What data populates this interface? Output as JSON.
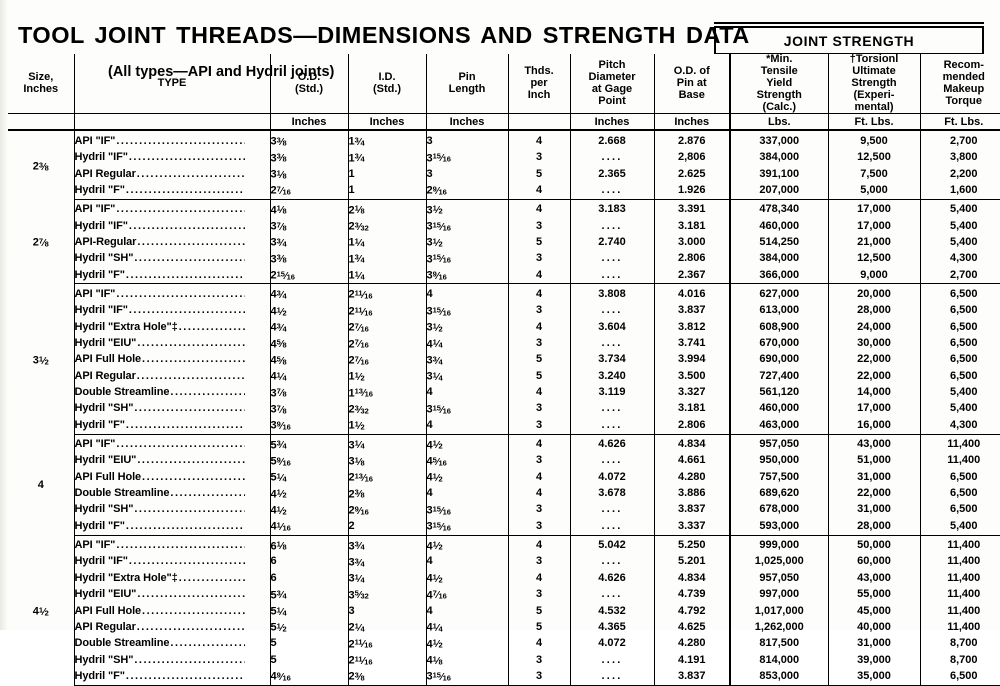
{
  "title": "TOOL JOINT THREADS—DIMENSIONS AND STRENGTH DATA",
  "subtitle": "(All types—API and Hydril joints)",
  "joint_strength_header": "JOINT STRENGTH",
  "columns": [
    {
      "id": "size",
      "label_lines": [
        "Size,",
        "Inches"
      ],
      "unit": ""
    },
    {
      "id": "type",
      "label_lines": [
        "TYPE"
      ],
      "unit": ""
    },
    {
      "id": "od",
      "label_lines": [
        "O.D.",
        "(Std.)"
      ],
      "unit": "Inches"
    },
    {
      "id": "id",
      "label_lines": [
        "I.D.",
        "(Std.)"
      ],
      "unit": "Inches"
    },
    {
      "id": "pin",
      "label_lines": [
        "Pin",
        "Length"
      ],
      "unit": "Inches"
    },
    {
      "id": "thds",
      "label_lines": [
        "Thds.",
        "per",
        "Inch"
      ],
      "unit": ""
    },
    {
      "id": "pitch",
      "label_lines": [
        "Pitch",
        "Diameter",
        "at Gage",
        "Point"
      ],
      "unit": "Inches"
    },
    {
      "id": "odpin",
      "label_lines": [
        "O.D. of",
        "Pin at",
        "Base"
      ],
      "unit": "Inches"
    },
    {
      "id": "tensile",
      "label_lines": [
        "*Min.",
        "Tensile",
        "Yield",
        "Strength",
        "(Calc.)"
      ],
      "unit": "Lbs."
    },
    {
      "id": "torsion",
      "label_lines": [
        "†Torsionl",
        "Ultimate",
        "Strength",
        "(Experi-",
        "mental)"
      ],
      "unit": "Ft. Lbs."
    },
    {
      "id": "torque",
      "label_lines": [
        "Recom-",
        "mended",
        "Makeup",
        "Torque"
      ],
      "unit": "Ft. Lbs."
    }
  ],
  "groups": [
    {
      "size": "2⅜",
      "rows": [
        {
          "type": "API \"IF\"",
          "od": "3⅜",
          "id": "1¾",
          "pin": "3",
          "thds": "4",
          "pitch": "2.668",
          "odpin": "2.876",
          "tensile": "337,000",
          "torsion": "9,500",
          "torque": "2,700"
        },
        {
          "type": "Hydril \"IF\"",
          "od": "3⅜",
          "id": "1¾",
          "pin": "3¹⁵⁄₁₆",
          "thds": "3",
          "pitch": "....",
          "odpin": "2,806",
          "tensile": "384,000",
          "torsion": "12,500",
          "torque": "3,800"
        },
        {
          "type": "API Regular",
          "od": "3⅛",
          "id": "1",
          "pin": "3",
          "thds": "5",
          "pitch": "2.365",
          "odpin": "2.625",
          "tensile": "391,100",
          "torsion": "7,500",
          "torque": "2,200"
        },
        {
          "type": "Hydril \"F\"",
          "od": "2⁷⁄₁₆",
          "id": "1",
          "pin": "2⁹⁄₁₆",
          "thds": "4",
          "pitch": "....",
          "odpin": "1.926",
          "tensile": "207,000",
          "torsion": "5,000",
          "torque": "1,600"
        }
      ]
    },
    {
      "size": "2⅞",
      "rows": [
        {
          "type": "API \"IF\"",
          "od": "4⅛",
          "id": "2⅛",
          "pin": "3½",
          "thds": "4",
          "pitch": "3.183",
          "odpin": "3.391",
          "tensile": "478,340",
          "torsion": "17,000",
          "torque": "5,400"
        },
        {
          "type": "Hydril \"IF\"",
          "od": "3⅞",
          "id": "2³⁄₃₂",
          "pin": "3¹⁵⁄₁₆",
          "thds": "3",
          "pitch": "....",
          "odpin": "3.181",
          "tensile": "460,000",
          "torsion": "17,000",
          "torque": "5,400"
        },
        {
          "type": "API-Regular",
          "od": "3¾",
          "id": "1¼",
          "pin": "3½",
          "thds": "5",
          "pitch": "2.740",
          "odpin": "3.000",
          "tensile": "514,250",
          "torsion": "21,000",
          "torque": "5,400"
        },
        {
          "type": "Hydril \"SH\"",
          "od": "3⅜",
          "id": "1¾",
          "pin": "3¹⁵⁄₁₆",
          "thds": "3",
          "pitch": "....",
          "odpin": "2.806",
          "tensile": "384,000",
          "torsion": "12,500",
          "torque": "4,300"
        },
        {
          "type": "Hydril \"F\"",
          "od": "2¹⁵⁄₁₆",
          "id": "1¼",
          "pin": "3⁹⁄₁₆",
          "thds": "4",
          "pitch": "....",
          "odpin": "2.367",
          "tensile": "366,000",
          "torsion": "9,000",
          "torque": "2,700"
        }
      ]
    },
    {
      "size": "3½",
      "rows": [
        {
          "type": "API \"IF\"",
          "od": "4¾",
          "id": "2¹¹⁄₁₆",
          "pin": "4",
          "thds": "4",
          "pitch": "3.808",
          "odpin": "4.016",
          "tensile": "627,000",
          "torsion": "20,000",
          "torque": "6,500"
        },
        {
          "type": "Hydril \"IF\"",
          "od": "4½",
          "id": "2¹¹⁄₁₆",
          "pin": "3¹⁵⁄₁₆",
          "thds": "3",
          "pitch": "....",
          "odpin": "3.837",
          "tensile": "613,000",
          "torsion": "28,000",
          "torque": "6,500"
        },
        {
          "type": "Hydril \"Extra Hole\"‡",
          "od": "4¾",
          "id": "2⁷⁄₁₆",
          "pin": "3½",
          "thds": "4",
          "pitch": "3.604",
          "odpin": "3.812",
          "tensile": "608,900",
          "torsion": "24,000",
          "torque": "6,500"
        },
        {
          "type": "Hydril \"EIU\"",
          "od": "4⅝",
          "id": "2⁷⁄₁₆",
          "pin": "4¼",
          "thds": "3",
          "pitch": "....",
          "odpin": "3.741",
          "tensile": "670,000",
          "torsion": "30,000",
          "torque": "6,500"
        },
        {
          "type": "API Full Hole",
          "od": "4⅝",
          "id": "2⁷⁄₁₆",
          "pin": "3¾",
          "thds": "5",
          "pitch": "3.734",
          "odpin": "3.994",
          "tensile": "690,000",
          "torsion": "22,000",
          "torque": "6,500"
        },
        {
          "type": "API Regular",
          "od": "4¼",
          "id": "1½",
          "pin": "3¼",
          "thds": "5",
          "pitch": "3.240",
          "odpin": "3.500",
          "tensile": "727,400",
          "torsion": "22,000",
          "torque": "6,500"
        },
        {
          "type": "Double Streamline",
          "od": "3⅞",
          "id": "1¹³⁄₁₆",
          "pin": "4",
          "thds": "4",
          "pitch": "3.119",
          "odpin": "3.327",
          "tensile": "561,120",
          "torsion": "14,000",
          "torque": "5,400"
        },
        {
          "type": "Hydril \"SH\"",
          "od": "3⅞",
          "id": "2³⁄₃₂",
          "pin": "3¹⁵⁄₁₆",
          "thds": "3",
          "pitch": "....",
          "odpin": "3.181",
          "tensile": "460,000",
          "torsion": "17,000",
          "torque": "5,400"
        },
        {
          "type": "Hydril \"F\"",
          "od": "3⁹⁄₁₆",
          "id": "1½",
          "pin": "4",
          "thds": "3",
          "pitch": "....",
          "odpin": "2.806",
          "tensile": "463,000",
          "torsion": "16,000",
          "torque": "4,300"
        }
      ]
    },
    {
      "size": "4",
      "rows": [
        {
          "type": "API \"IF\"",
          "od": "5¾",
          "id": "3¼",
          "pin": "4½",
          "thds": "4",
          "pitch": "4.626",
          "odpin": "4.834",
          "tensile": "957,050",
          "torsion": "43,000",
          "torque": "11,400"
        },
        {
          "type": "Hydril \"EIU\"",
          "od": "5⁹⁄₁₆",
          "id": "3⅛",
          "pin": "4⁵⁄₁₆",
          "thds": "3",
          "pitch": "....",
          "odpin": "4.661",
          "tensile": "950,000",
          "torsion": "51,000",
          "torque": "11,400"
        },
        {
          "type": "API Full Hole",
          "od": "5¼",
          "id": "2¹³⁄₁₆",
          "pin": "4½",
          "thds": "4",
          "pitch": "4.072",
          "odpin": "4.280",
          "tensile": "757,500",
          "torsion": "31,000",
          "torque": "6,500"
        },
        {
          "type": "Double Streamline",
          "od": "4½",
          "id": "2⅜",
          "pin": "4",
          "thds": "4",
          "pitch": "3.678",
          "odpin": "3.886",
          "tensile": "689,620",
          "torsion": "22,000",
          "torque": "6,500"
        },
        {
          "type": "Hydril \"SH\"",
          "od": "4½",
          "id": "2⁹⁄₁₆",
          "pin": "3¹⁵⁄₁₆",
          "thds": "3",
          "pitch": "....",
          "odpin": "3.837",
          "tensile": "678,000",
          "torsion": "31,000",
          "torque": "6,500"
        },
        {
          "type": "Hydril \"F\"",
          "od": "4¹⁄₁₆",
          "id": "2",
          "pin": "3¹⁵⁄₁₆",
          "thds": "3",
          "pitch": "....",
          "odpin": "3.337",
          "tensile": "593,000",
          "torsion": "28,000",
          "torque": "5,400"
        }
      ]
    },
    {
      "size": "4½",
      "rows": [
        {
          "type": "API \"IF\"",
          "od": "6⅛",
          "id": "3¾",
          "pin": "4½",
          "thds": "4",
          "pitch": "5.042",
          "odpin": "5.250",
          "tensile": "999,000",
          "torsion": "50,000",
          "torque": "11,400"
        },
        {
          "type": "Hydril \"IF\"",
          "od": "6",
          "id": "3¾",
          "pin": "4",
          "thds": "3",
          "pitch": "....",
          "odpin": "5.201",
          "tensile": "1,025,000",
          "torsion": "60,000",
          "torque": "11,400"
        },
        {
          "type": "Hydril \"Extra Hole\"‡",
          "od": "6",
          "id": "3¼",
          "pin": "4½",
          "thds": "4",
          "pitch": "4.626",
          "odpin": "4.834",
          "tensile": "957,050",
          "torsion": "43,000",
          "torque": "11,400"
        },
        {
          "type": "Hydril \"EIU\"",
          "od": "5¾",
          "id": "3⁵⁄₃₂",
          "pin": "4⁷⁄₁₆",
          "thds": "3",
          "pitch": "....",
          "odpin": "4.739",
          "tensile": "997,000",
          "torsion": "55,000",
          "torque": "11,400"
        },
        {
          "type": "API Full Hole",
          "od": "5¼",
          "id": "3",
          "pin": "4",
          "thds": "5",
          "pitch": "4.532",
          "odpin": "4.792",
          "tensile": "1,017,000",
          "torsion": "45,000",
          "torque": "11,400"
        },
        {
          "type": "API Regular",
          "od": "5½",
          "id": "2¼",
          "pin": "4¼",
          "thds": "5",
          "pitch": "4.365",
          "odpin": "4.625",
          "tensile": "1,262,000",
          "torsion": "40,000",
          "torque": "11,400"
        },
        {
          "type": "Double Streamline",
          "od": "5",
          "id": "2¹¹⁄₁₆",
          "pin": "4½",
          "thds": "4",
          "pitch": "4.072",
          "odpin": "4.280",
          "tensile": "817,500",
          "torsion": "31,000",
          "torque": "8,700"
        },
        {
          "type": "Hydril \"SH\"",
          "od": "5",
          "id": "2¹¹⁄₁₆",
          "pin": "4⅛",
          "thds": "3",
          "pitch": "....",
          "odpin": "4.191",
          "tensile": "814,000",
          "torsion": "39,000",
          "torque": "8,700"
        },
        {
          "type": "Hydril \"F\"",
          "od": "4⁹⁄₁₆",
          "id": "2⅜",
          "pin": "3¹⁵⁄₁₆",
          "thds": "3",
          "pitch": "....",
          "odpin": "3.837",
          "tensile": "853,000",
          "torsion": "35,000",
          "torque": "6,500"
        }
      ]
    }
  ]
}
